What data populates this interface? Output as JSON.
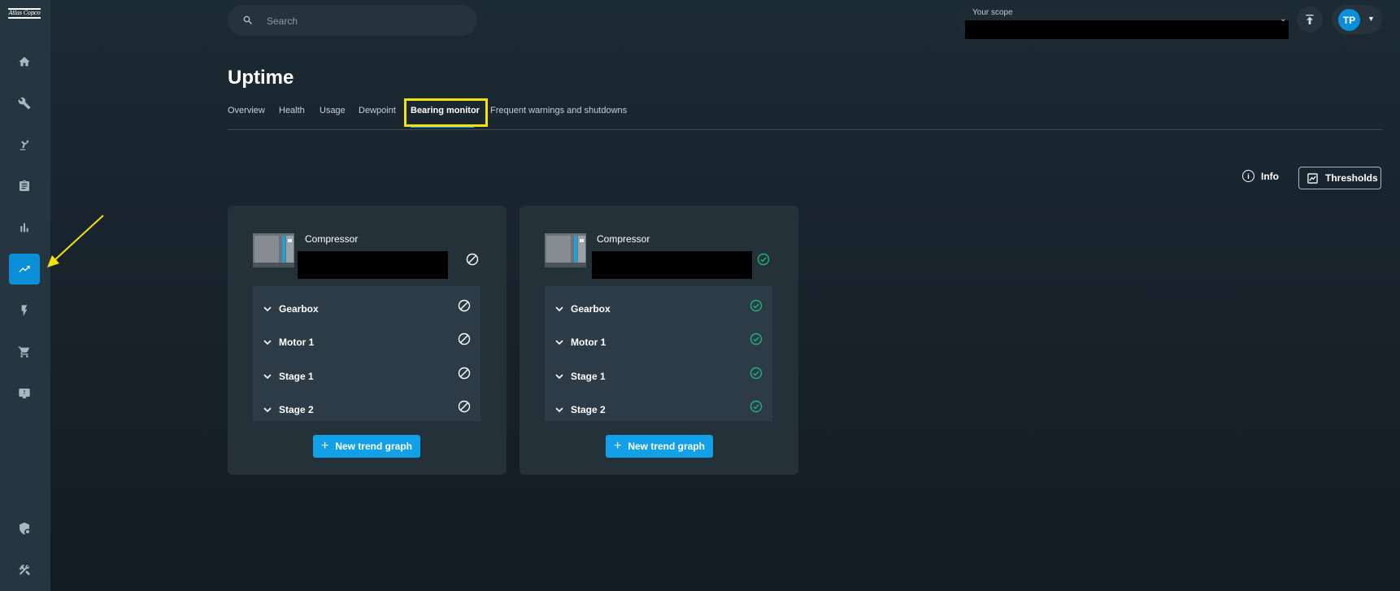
{
  "brand": {
    "logo_text": "Atlas Copco"
  },
  "sidebar": {
    "items": [
      {
        "icon": "home-icon"
      },
      {
        "icon": "wrench-icon"
      },
      {
        "icon": "robot-arm-icon"
      },
      {
        "icon": "clipboard-icon"
      },
      {
        "icon": "bar-chart-icon"
      },
      {
        "icon": "trending-up-icon",
        "active": true
      },
      {
        "icon": "lightning-icon"
      },
      {
        "icon": "cart-icon"
      },
      {
        "icon": "feedback-icon"
      },
      {
        "icon": "shield-settings-icon"
      },
      {
        "icon": "tools-icon"
      }
    ]
  },
  "search": {
    "placeholder": "Search"
  },
  "scope": {
    "label": "Your scope"
  },
  "user": {
    "initials": "TP"
  },
  "page": {
    "title": "Uptime"
  },
  "tabs": [
    {
      "label": "Overview"
    },
    {
      "label": "Health"
    },
    {
      "label": "Usage"
    },
    {
      "label": "Dewpoint"
    },
    {
      "label": "Bearing monitor",
      "active": true
    },
    {
      "label": "Frequent warnings and shutdowns"
    }
  ],
  "actions": {
    "info_label": "Info",
    "thresholds_label": "Thresholds"
  },
  "cards": [
    {
      "machine_type": "Compressor",
      "status": "disabled",
      "components": [
        {
          "name": "Gearbox",
          "status": "disabled"
        },
        {
          "name": "Motor 1",
          "status": "disabled"
        },
        {
          "name": "Stage 1",
          "status": "disabled"
        },
        {
          "name": "Stage 2",
          "status": "disabled"
        }
      ],
      "button_label": "New trend graph"
    },
    {
      "machine_type": "Compressor",
      "status": "ok",
      "components": [
        {
          "name": "Gearbox",
          "status": "ok"
        },
        {
          "name": "Motor 1",
          "status": "ok"
        },
        {
          "name": "Stage 1",
          "status": "ok"
        },
        {
          "name": "Stage 2",
          "status": "ok"
        }
      ],
      "button_label": "New trend graph"
    }
  ],
  "colors": {
    "accent": "#0a8fd8",
    "ok": "#1fb37a",
    "highlight": "#f2e20a"
  }
}
